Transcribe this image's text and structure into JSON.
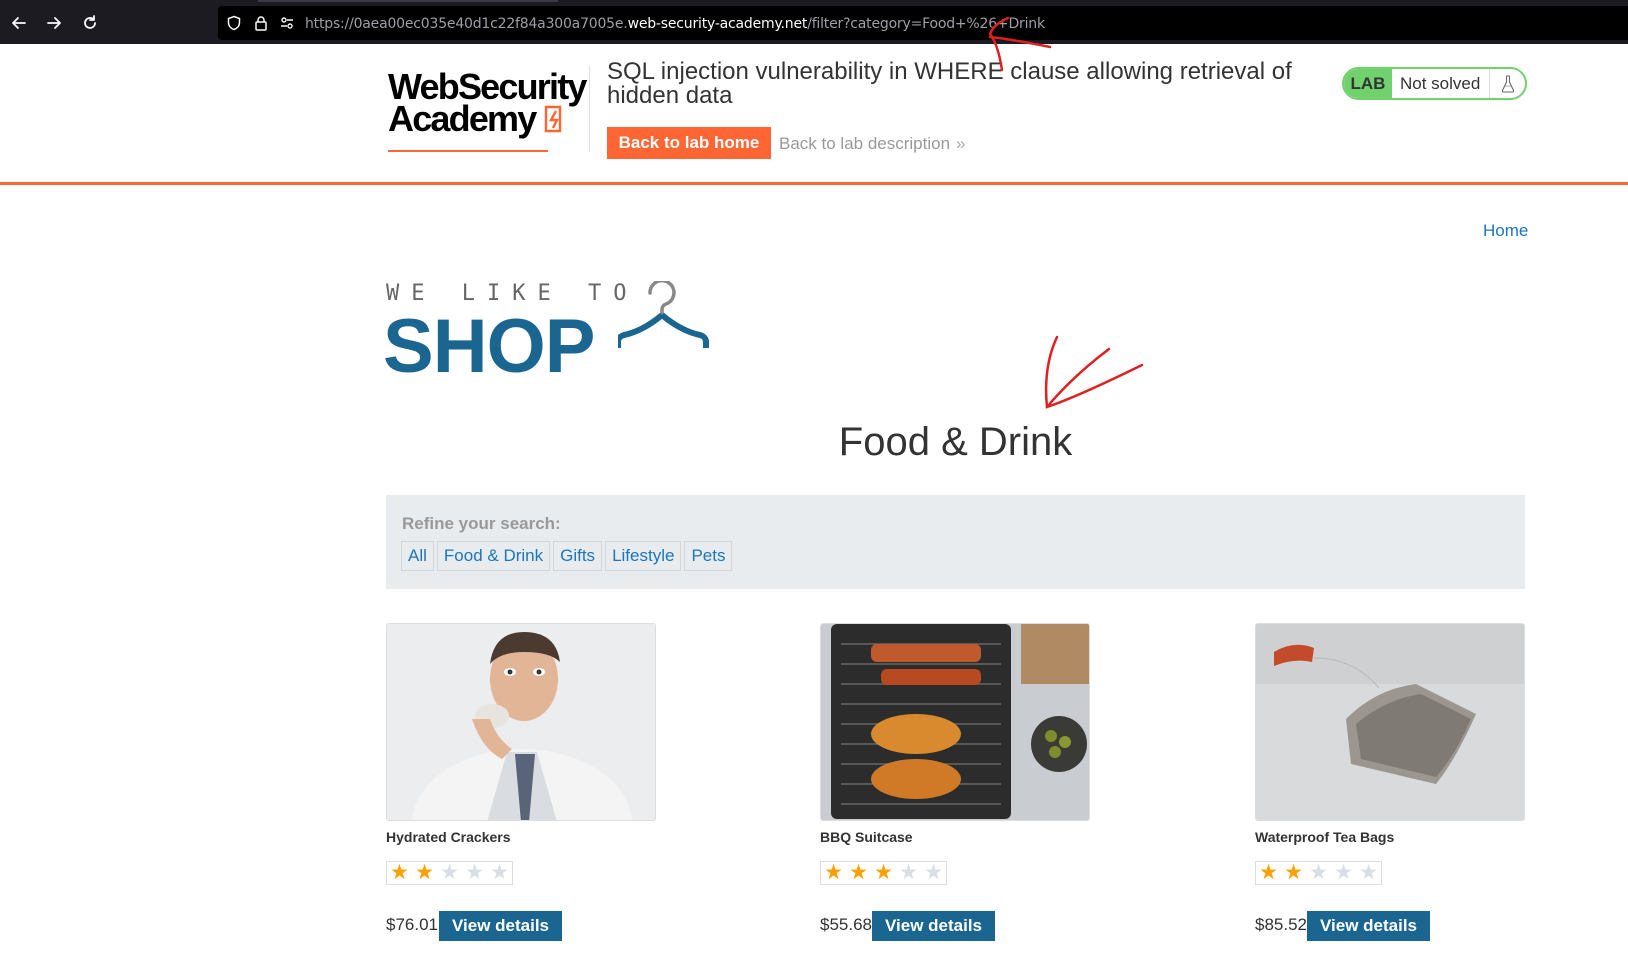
{
  "browser": {
    "url_prefix": "https://0aea00ec035e40d1c22f84a300a7005e.",
    "url_host": "web-security-academy.net",
    "url_path": "/filter?category=Food+%26+Drink",
    "back_icon": "arrow-left-icon",
    "forward_icon": "arrow-right-icon",
    "reload_icon": "reload-icon"
  },
  "academy": {
    "logo_line1": "WebSecurity",
    "logo_line2": "Academy",
    "lab_title": "SQL injection vulnerability in WHERE clause allowing retrieval of hidden data",
    "back_to_lab_home": "Back to lab home",
    "back_to_lab_description": "Back to lab description",
    "lab_badge": "LAB",
    "lab_status": "Not solved",
    "accent_color": "#ff6633",
    "solved_color": "#70d16d"
  },
  "shop": {
    "home_link": "Home",
    "logo_tagline": "WE LIKE TO",
    "logo_word": "SHOP",
    "page_title": "Food & Drink",
    "refine_label": "Refine your search:",
    "filters": [
      "All",
      "Food & Drink",
      "Gifts",
      "Lifestyle",
      "Pets"
    ],
    "view_details_label": "View details",
    "brand_color": "#1a6690"
  },
  "products": [
    {
      "name": "Hydrated Crackers",
      "rating": 2,
      "max_rating": 5,
      "price": "$76.01"
    },
    {
      "name": "BBQ Suitcase",
      "rating": 3,
      "max_rating": 5,
      "price": "$55.68"
    },
    {
      "name": "Waterproof Tea Bags",
      "rating": 2,
      "max_rating": 5,
      "price": "$85.52"
    }
  ]
}
